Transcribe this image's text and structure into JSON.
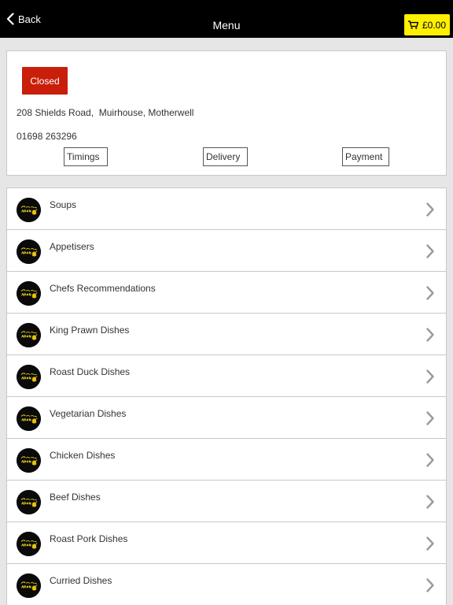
{
  "navbar": {
    "back_label": "Back",
    "title": "Menu",
    "cart_total": "£0.00",
    "cart_color": "#ffef00"
  },
  "restaurant": {
    "status": "Closed",
    "status_color": "#c81e0a",
    "address": "208 Shields Road,  Muirhouse, Motherwell",
    "phone": "01698 263296",
    "buttons": {
      "timings": "Timings",
      "delivery": "Delivery",
      "payment": "Payment"
    }
  },
  "categories": [
    {
      "label": "Soups",
      "icon": "restaurant-logo-icon"
    },
    {
      "label": "Appetisers",
      "icon": "restaurant-logo-icon"
    },
    {
      "label": "Chefs Recommendations",
      "icon": "restaurant-logo-icon"
    },
    {
      "label": "King Prawn Dishes",
      "icon": "restaurant-logo-icon"
    },
    {
      "label": "Roast Duck Dishes",
      "icon": "restaurant-logo-icon"
    },
    {
      "label": "Vegetarian Dishes",
      "icon": "restaurant-logo-icon"
    },
    {
      "label": "Chicken Dishes",
      "icon": "restaurant-logo-icon"
    },
    {
      "label": "Beef Dishes",
      "icon": "restaurant-logo-icon"
    },
    {
      "label": "Roast Pork Dishes",
      "icon": "restaurant-logo-icon"
    },
    {
      "label": "Curried Dishes",
      "icon": "restaurant-logo-icon"
    }
  ]
}
